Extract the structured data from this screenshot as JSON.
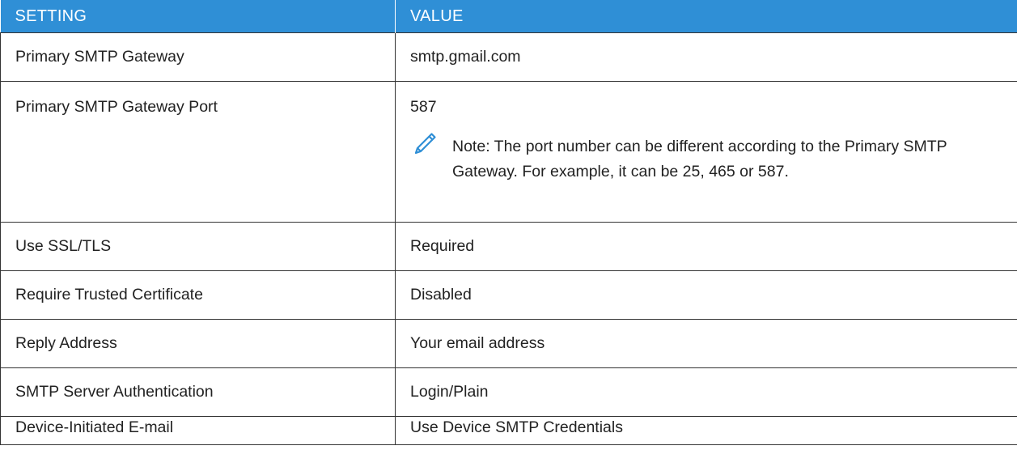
{
  "table": {
    "headers": {
      "setting": "SETTING",
      "value": "VALUE"
    },
    "rows": [
      {
        "setting": "Primary SMTP Gateway",
        "value": "smtp.gmail.com"
      },
      {
        "setting": "Primary SMTP Gateway Port",
        "value": "587",
        "note": "Note: The port number can be different according to the Primary SMTP Gateway. For example, it can be 25, 465 or 587."
      },
      {
        "setting": "Use SSL/TLS",
        "value": "Required"
      },
      {
        "setting": "Require Trusted Certificate",
        "value": "Disabled"
      },
      {
        "setting": "Reply Address",
        "value": "Your email address"
      },
      {
        "setting": "SMTP Server Authentication",
        "value": "Login/Plain"
      },
      {
        "setting": "Device-Initiated E-mail",
        "value": "Use Device SMTP Credentials"
      }
    ]
  },
  "icons": {
    "note": "pencil-icon"
  },
  "colors": {
    "header_bg": "#2f8fd6",
    "icon": "#2f8fd6"
  }
}
